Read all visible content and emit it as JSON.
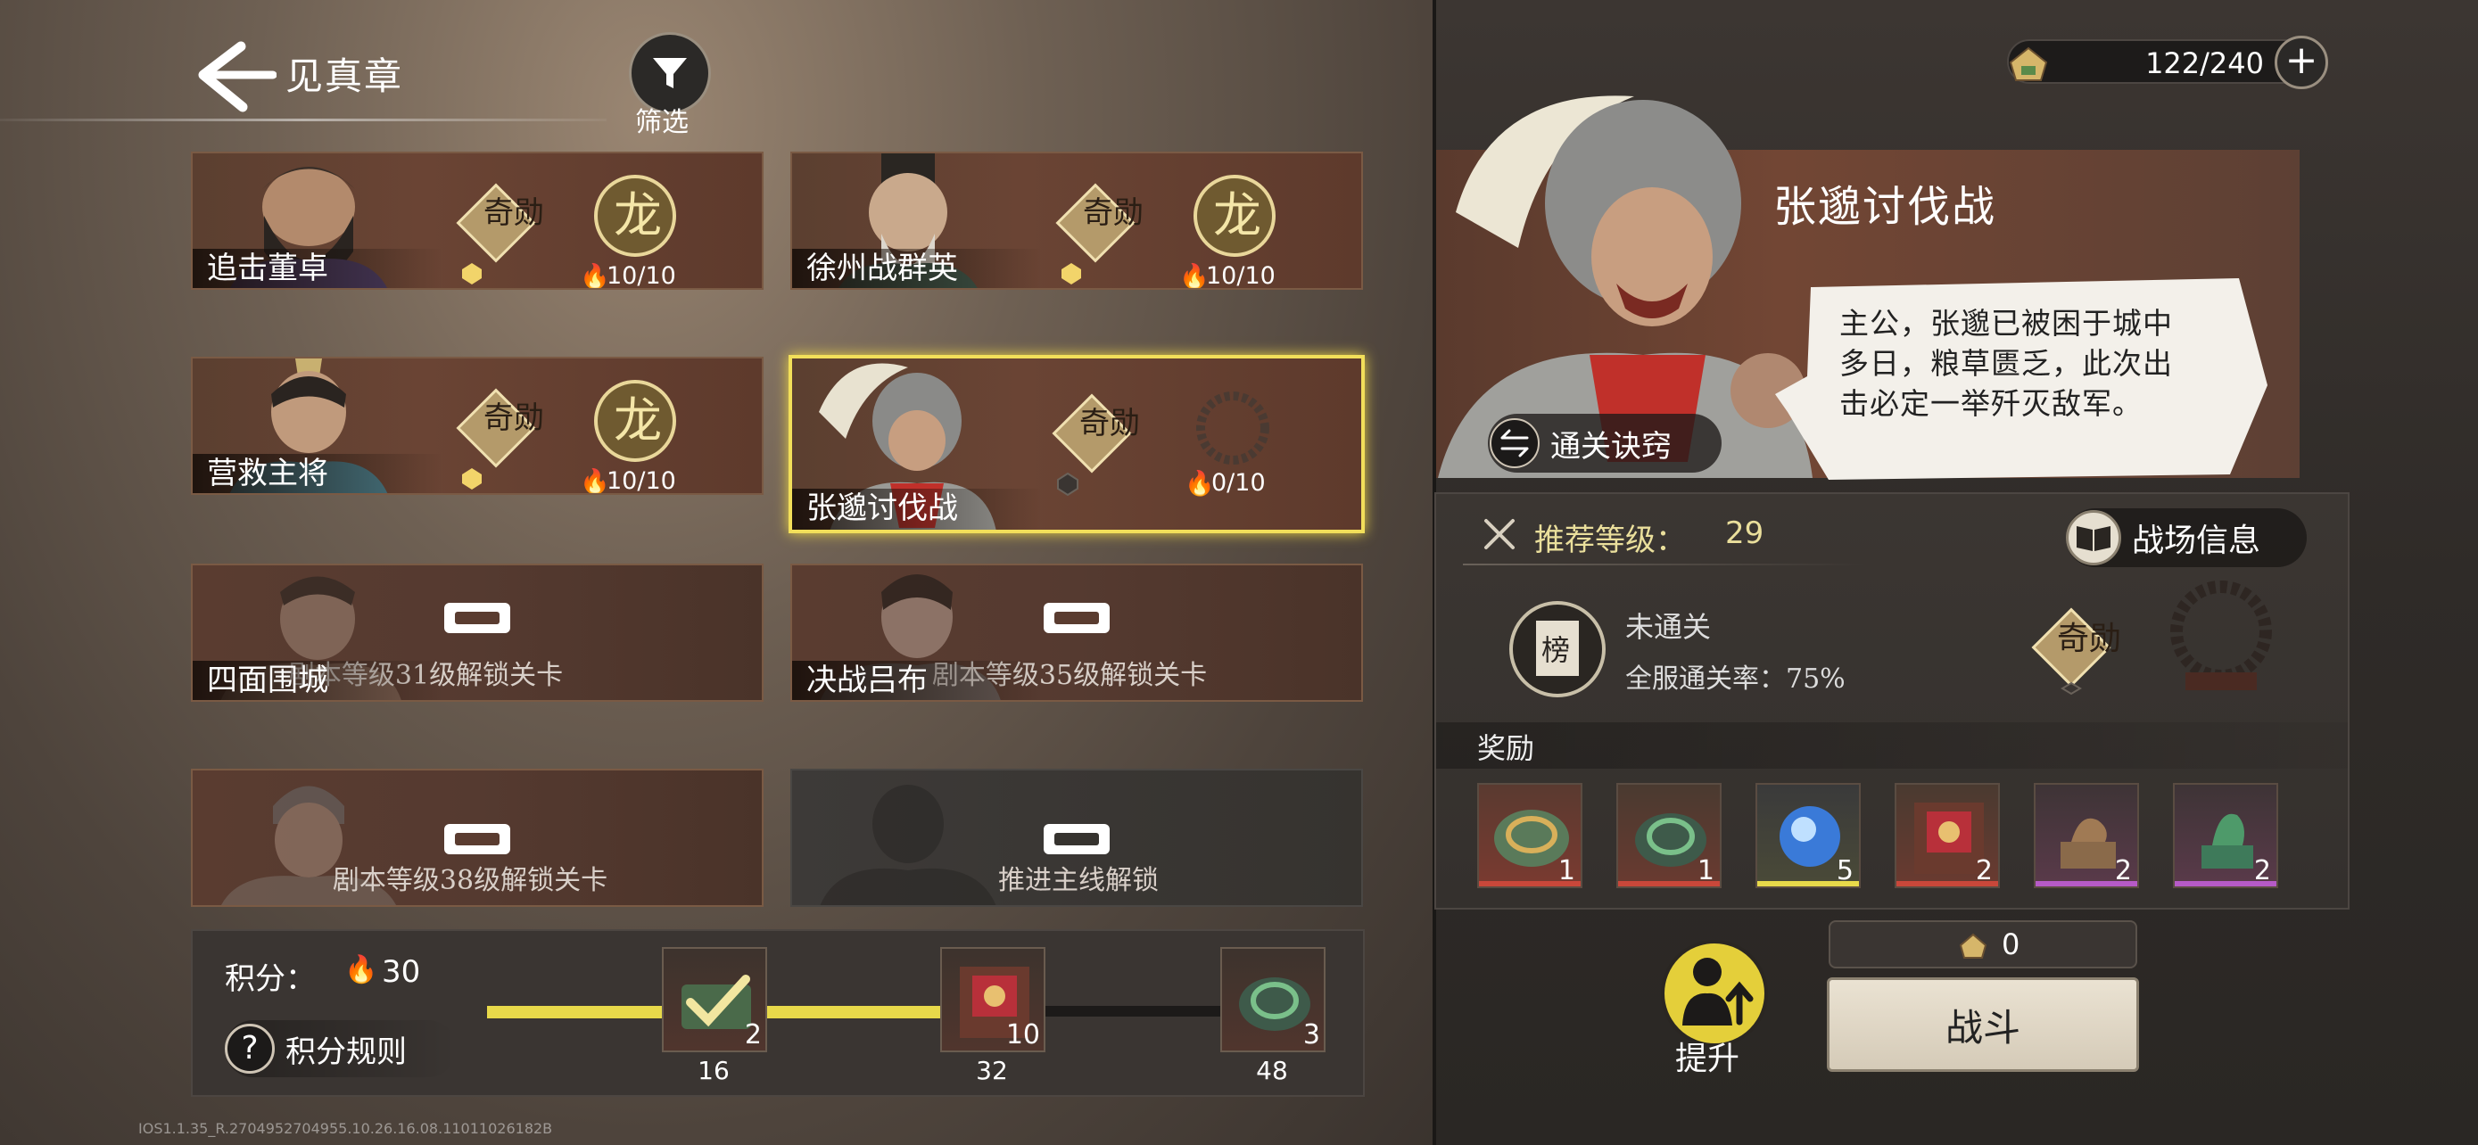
{
  "header": {
    "chapter_title": "见真章",
    "filter_label": "筛选"
  },
  "stages": [
    {
      "name": "追击董卓",
      "badge_qi": "奇勋",
      "badge_long": "龙",
      "fire": "10/10"
    },
    {
      "name": "徐州战群英",
      "badge_qi": "奇勋",
      "badge_long": "龙",
      "fire": "10/10"
    },
    {
      "name": "营救主将",
      "badge_qi": "奇勋",
      "badge_long": "龙",
      "fire": "10/10"
    },
    {
      "name": "张邈讨伐战",
      "badge_qi": "奇勋",
      "fire": "0/10"
    },
    {
      "name": "四面围城",
      "lock_text": "剧本等级31级解锁关卡"
    },
    {
      "name": "决战吕布",
      "lock_text": "剧本等级35级解锁关卡"
    },
    {
      "name": "",
      "lock_text": "剧本等级38级解锁关卡"
    },
    {
      "name": "",
      "lock_text": "推进主线解锁"
    }
  ],
  "score": {
    "label": "积分：",
    "value": "30",
    "rules_label": "积分规则",
    "progress_fraction": 0.625,
    "milestones": [
      {
        "points": "16",
        "count": "2"
      },
      {
        "points": "32",
        "count": "10"
      },
      {
        "points": "48",
        "count": "3"
      }
    ]
  },
  "build_info": "IOS1.1.35_R.2704952704955.10.26.16.08.11011026182B",
  "stamina": {
    "value": "122/240",
    "plus": "+"
  },
  "detail": {
    "title": "张邈讨伐战",
    "speech": "主公，张邈已被困于城中多日，粮草匮乏，此次出击必定一举歼灭敌军。",
    "tips_label": "通关诀窍",
    "rec_label": "推荐等级：",
    "rec_value": "29",
    "battlefield_info": "战场信息",
    "rank_char": "榜",
    "clear_status": "未通关",
    "clear_rate": "全服通关率：75%",
    "badge_qi": "奇勋",
    "rewards_label": "奖励",
    "rewards": [
      {
        "count": "1",
        "rarity_color": "#c9473a"
      },
      {
        "count": "1",
        "rarity_color": "#c9473a"
      },
      {
        "count": "5",
        "rarity_color": "#e8d94a"
      },
      {
        "count": "2",
        "rarity_color": "#c9473a"
      },
      {
        "count": "2",
        "rarity_color": "#b65ac7"
      },
      {
        "count": "2",
        "rarity_color": "#b65ac7"
      }
    ],
    "cost_value": "0",
    "battle_label": "战斗",
    "upgrade_label": "提升"
  }
}
